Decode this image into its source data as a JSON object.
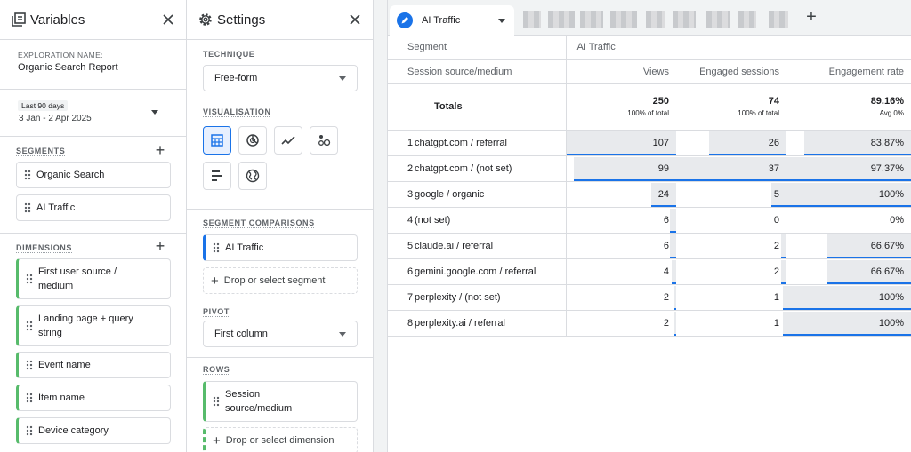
{
  "variables": {
    "title": "Variables",
    "exploration_name_label": "EXPLORATION NAME:",
    "exploration_name": "Organic Search Report",
    "date_range_label": "Last 90 days",
    "date_range": "3 Jan - 2 Apr 2025",
    "segments_label": "SEGMENTS",
    "segments": [
      "Organic Search",
      "AI Traffic"
    ],
    "dimensions_label": "DIMENSIONS",
    "dimensions": [
      "First user source / medium",
      "Landing page + query string",
      "Event name",
      "Item name",
      "Device category"
    ]
  },
  "settings": {
    "title": "Settings",
    "technique_label": "TECHNIQUE",
    "technique": "Free-form",
    "visualisation_label": "VISUALISATION",
    "segment_comparisons_label": "SEGMENT COMPARISONS",
    "segment_comparison": "AI Traffic",
    "drop_segment": "Drop or select segment",
    "pivot_label": "PIVOT",
    "pivot": "First column",
    "rows_label": "ROWS",
    "row_dimension": "Session source/medium",
    "drop_dimension": "Drop or select dimension"
  },
  "tabs": {
    "active": "AI Traffic",
    "add_icon": "plus-icon"
  },
  "table": {
    "segment_header": "Segment",
    "segment_value": "AI Traffic",
    "dimension_header": "Session source/medium",
    "metrics": [
      "Views",
      "Engaged sessions",
      "Engagement rate"
    ],
    "totals_label": "Totals",
    "totals": [
      {
        "value": "250",
        "sub": "100% of total"
      },
      {
        "value": "74",
        "sub": "100% of total"
      },
      {
        "value": "89.16%",
        "sub": "Avg 0%"
      }
    ],
    "rows": [
      {
        "idx": "1",
        "name": "chatgpt.com / referral",
        "views": "107",
        "engaged": "26",
        "rate": "83.87%",
        "views_frac": 1.0,
        "engaged_frac": 0.7,
        "rate_frac": 0.86
      },
      {
        "idx": "2",
        "name": "chatgpt.com / (not set)",
        "views": "99",
        "engaged": "37",
        "rate": "97.37%",
        "views_frac": 0.93,
        "engaged_frac": 1.0,
        "rate_frac": 1.0
      },
      {
        "idx": "3",
        "name": "google / organic",
        "views": "24",
        "engaged": "5",
        "rate": "100%",
        "views_frac": 0.23,
        "engaged_frac": 0.14,
        "rate_frac": 1.0
      },
      {
        "idx": "4",
        "name": "(not set)",
        "views": "6",
        "engaged": "0",
        "rate": "0%",
        "views_frac": 0.06,
        "engaged_frac": 0,
        "rate_frac": 0
      },
      {
        "idx": "5",
        "name": "claude.ai / referral",
        "views": "6",
        "engaged": "2",
        "rate": "66.67%",
        "views_frac": 0.06,
        "engaged_frac": 0.05,
        "rate_frac": 0.67
      },
      {
        "idx": "6",
        "name": "gemini.google.com / referral",
        "views": "4",
        "engaged": "2",
        "rate": "66.67%",
        "views_frac": 0.04,
        "engaged_frac": 0.05,
        "rate_frac": 0.67
      },
      {
        "idx": "7",
        "name": "perplexity / (not set)",
        "views": "2",
        "engaged": "1",
        "rate": "100%",
        "views_frac": 0.02,
        "engaged_frac": 0.03,
        "rate_frac": 1.0
      },
      {
        "idx": "8",
        "name": "perplexity.ai / referral",
        "views": "2",
        "engaged": "1",
        "rate": "100%",
        "views_frac": 0.02,
        "engaged_frac": 0.03,
        "rate_frac": 1.0
      }
    ]
  },
  "colors": {
    "accent": "#1a73e8",
    "dimension": "#57bb6b",
    "bar": "#e8eaed"
  }
}
